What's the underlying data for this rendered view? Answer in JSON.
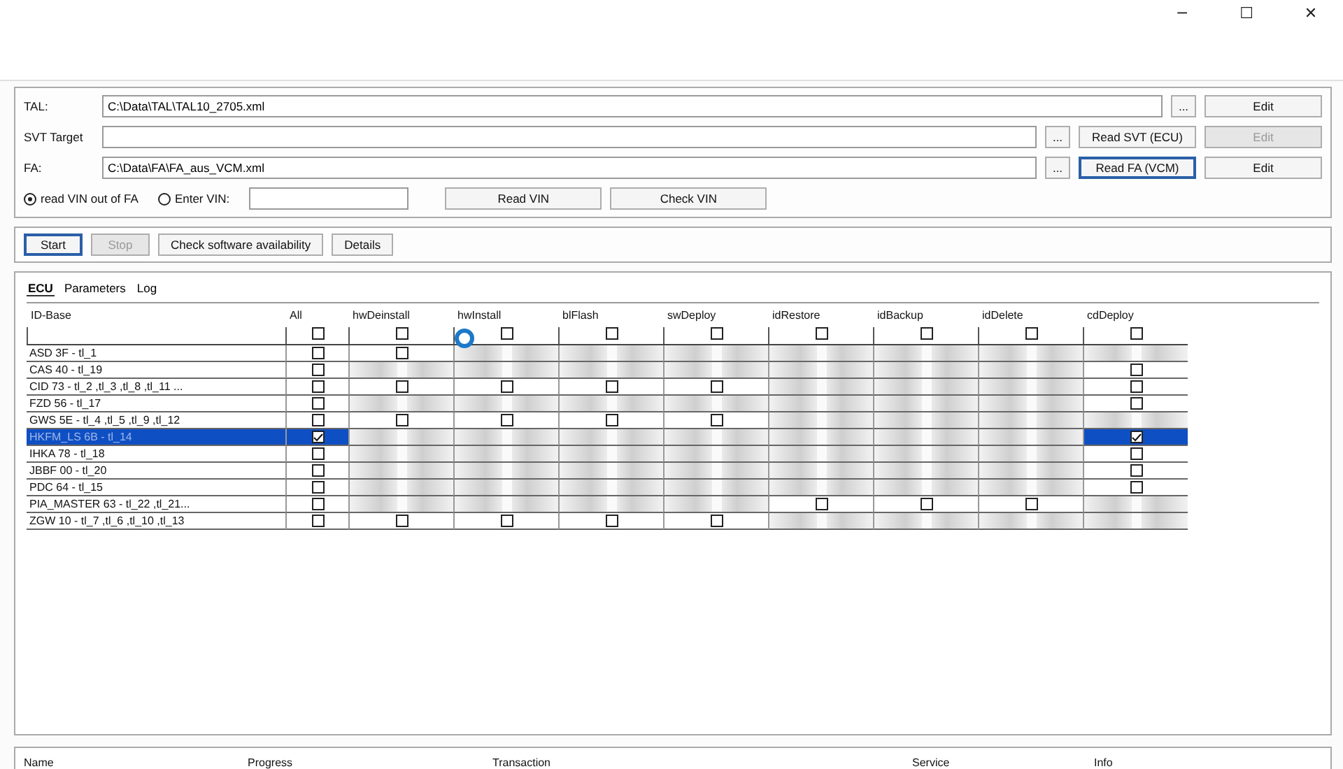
{
  "window": {
    "controls": [
      "─",
      "☐",
      "✕"
    ]
  },
  "form": {
    "rows": [
      {
        "label": "TAL:",
        "value": "C:\\Data\\TAL\\TAL10_2705.xml",
        "browse": "...",
        "actions": [
          {
            "label": "Edit",
            "disabled": false,
            "focused": false
          }
        ]
      },
      {
        "label": "SVT Target",
        "value": "",
        "browse": "...",
        "actions": [
          {
            "label": "Read SVT (ECU)",
            "disabled": false,
            "focused": false
          },
          {
            "label": "Edit",
            "disabled": true,
            "focused": false
          }
        ]
      },
      {
        "label": "FA:",
        "value": "C:\\Data\\FA\\FA_aus_VCM.xml",
        "browse": "...",
        "actions": [
          {
            "label": "Read FA (VCM)",
            "disabled": false,
            "focused": true
          },
          {
            "label": "Edit",
            "disabled": false,
            "focused": false
          }
        ]
      }
    ],
    "vin_options": [
      {
        "label": "read VIN out of FA",
        "selected": true
      },
      {
        "label": "Enter VIN:",
        "selected": false
      }
    ],
    "vin_buttons": [
      "Read VIN",
      "Check VIN"
    ]
  },
  "toolbar": [
    {
      "label": "Start",
      "disabled": false,
      "focused": true
    },
    {
      "label": "Stop",
      "disabled": true,
      "focused": false
    },
    {
      "label": "Check software availability",
      "disabled": false,
      "focused": false
    },
    {
      "label": "Details",
      "disabled": false,
      "focused": false
    }
  ],
  "tabs": [
    {
      "label": "ECU",
      "selected": true
    },
    {
      "label": "Parameters",
      "selected": false
    },
    {
      "label": "Log",
      "selected": false
    }
  ],
  "table": {
    "columns": [
      {
        "label": "ID-Base"
      },
      {
        "label": "All",
        "checked": false
      },
      {
        "label": "hwDeinstall",
        "checked": false
      },
      {
        "label": "hwInstall",
        "checked": false
      },
      {
        "label": "blFlash",
        "checked": false
      },
      {
        "label": "swDeploy",
        "checked": false
      },
      {
        "label": "idRestore",
        "checked": false
      },
      {
        "label": "idBackup",
        "checked": false
      },
      {
        "label": "idDelete",
        "checked": false
      },
      {
        "label": "cdDeploy",
        "checked": false
      }
    ],
    "rows": [
      {
        "name": "ASD 3F - tl_1",
        "selected": false,
        "cells": [
          {
            "kind": "checkbox",
            "checked": false
          },
          {
            "kind": "checkbox",
            "checked": false
          },
          {
            "kind": "unavailable"
          },
          {
            "kind": "unavailable"
          },
          {
            "kind": "unavailable"
          },
          {
            "kind": "unavailable"
          },
          {
            "kind": "unavailable"
          },
          {
            "kind": "unavailable"
          },
          {
            "kind": "unavailable"
          }
        ]
      },
      {
        "name": "CAS 40 - tl_19",
        "selected": false,
        "cells": [
          {
            "kind": "checkbox",
            "checked": false
          },
          {
            "kind": "unavailable"
          },
          {
            "kind": "unavailable"
          },
          {
            "kind": "unavailable"
          },
          {
            "kind": "unavailable"
          },
          {
            "kind": "unavailable"
          },
          {
            "kind": "unavailable"
          },
          {
            "kind": "unavailable"
          },
          {
            "kind": "checkbox",
            "checked": false
          }
        ]
      },
      {
        "name": "CID 73 - tl_2 ,tl_3 ,tl_8 ,tl_11 ...",
        "selected": false,
        "cells": [
          {
            "kind": "checkbox",
            "checked": false
          },
          {
            "kind": "checkbox",
            "checked": false
          },
          {
            "kind": "checkbox",
            "checked": false
          },
          {
            "kind": "checkbox",
            "checked": false
          },
          {
            "kind": "checkbox",
            "checked": false
          },
          {
            "kind": "unavailable"
          },
          {
            "kind": "unavailable"
          },
          {
            "kind": "unavailable"
          },
          {
            "kind": "checkbox",
            "checked": false
          }
        ]
      },
      {
        "name": "FZD 56 - tl_17",
        "selected": false,
        "cells": [
          {
            "kind": "checkbox",
            "checked": false
          },
          {
            "kind": "unavailable"
          },
          {
            "kind": "unavailable"
          },
          {
            "kind": "unavailable"
          },
          {
            "kind": "unavailable"
          },
          {
            "kind": "unavailable"
          },
          {
            "kind": "unavailable"
          },
          {
            "kind": "unavailable"
          },
          {
            "kind": "checkbox",
            "checked": false
          }
        ]
      },
      {
        "name": "GWS 5E - tl_4 ,tl_5 ,tl_9 ,tl_12",
        "selected": false,
        "cells": [
          {
            "kind": "checkbox",
            "checked": false
          },
          {
            "kind": "checkbox",
            "checked": false
          },
          {
            "kind": "checkbox",
            "checked": false
          },
          {
            "kind": "checkbox",
            "checked": false
          },
          {
            "kind": "checkbox",
            "checked": false
          },
          {
            "kind": "unavailable"
          },
          {
            "kind": "unavailable"
          },
          {
            "kind": "unavailable"
          },
          {
            "kind": "unavailable"
          }
        ]
      },
      {
        "name": "HKFM_LS 6B - tl_14",
        "selected": true,
        "cells": [
          {
            "kind": "checkbox",
            "checked": true
          },
          {
            "kind": "unavailable"
          },
          {
            "kind": "unavailable"
          },
          {
            "kind": "unavailable"
          },
          {
            "kind": "unavailable"
          },
          {
            "kind": "unavailable"
          },
          {
            "kind": "unavailable"
          },
          {
            "kind": "unavailable"
          },
          {
            "kind": "checkbox",
            "checked": true
          }
        ]
      },
      {
        "name": "IHKA 78 - tl_18",
        "selected": false,
        "cells": [
          {
            "kind": "checkbox",
            "checked": false
          },
          {
            "kind": "unavailable"
          },
          {
            "kind": "unavailable"
          },
          {
            "kind": "unavailable"
          },
          {
            "kind": "unavailable"
          },
          {
            "kind": "unavailable"
          },
          {
            "kind": "unavailable"
          },
          {
            "kind": "unavailable"
          },
          {
            "kind": "checkbox",
            "checked": false
          }
        ]
      },
      {
        "name": "JBBF 00 - tl_20",
        "selected": false,
        "cells": [
          {
            "kind": "checkbox",
            "checked": false
          },
          {
            "kind": "unavailable"
          },
          {
            "kind": "unavailable"
          },
          {
            "kind": "unavailable"
          },
          {
            "kind": "unavailable"
          },
          {
            "kind": "unavailable"
          },
          {
            "kind": "unavailable"
          },
          {
            "kind": "unavailable"
          },
          {
            "kind": "checkbox",
            "checked": false
          }
        ]
      },
      {
        "name": "PDC 64 - tl_15",
        "selected": false,
        "cells": [
          {
            "kind": "checkbox",
            "checked": false
          },
          {
            "kind": "unavailable"
          },
          {
            "kind": "unavailable"
          },
          {
            "kind": "unavailable"
          },
          {
            "kind": "unavailable"
          },
          {
            "kind": "unavailable"
          },
          {
            "kind": "unavailable"
          },
          {
            "kind": "unavailable"
          },
          {
            "kind": "checkbox",
            "checked": false
          }
        ]
      },
      {
        "name": "PIA_MASTER 63 - tl_22 ,tl_21...",
        "selected": false,
        "cells": [
          {
            "kind": "checkbox",
            "checked": false
          },
          {
            "kind": "unavailable"
          },
          {
            "kind": "unavailable"
          },
          {
            "kind": "unavailable"
          },
          {
            "kind": "unavailable"
          },
          {
            "kind": "checkbox",
            "checked": false
          },
          {
            "kind": "checkbox",
            "checked": false
          },
          {
            "kind": "checkbox",
            "checked": false
          },
          {
            "kind": "unavailable"
          }
        ]
      },
      {
        "name": "ZGW 10 - tl_7 ,tl_6 ,tl_10 ,tl_13",
        "selected": false,
        "cells": [
          {
            "kind": "checkbox",
            "checked": false
          },
          {
            "kind": "checkbox",
            "checked": false
          },
          {
            "kind": "checkbox",
            "checked": false
          },
          {
            "kind": "checkbox",
            "checked": false
          },
          {
            "kind": "checkbox",
            "checked": false
          },
          {
            "kind": "unavailable"
          },
          {
            "kind": "unavailable"
          },
          {
            "kind": "unavailable"
          },
          {
            "kind": "unavailable"
          }
        ]
      }
    ]
  },
  "status_table": {
    "columns": [
      "Name",
      "Progress",
      "Transaction",
      "Service",
      "Info"
    ]
  }
}
